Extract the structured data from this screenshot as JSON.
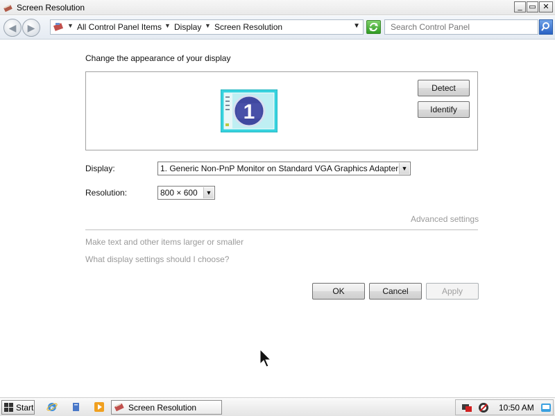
{
  "window": {
    "title": "Screen Resolution",
    "minimize_glyph": "_",
    "maximize_glyph": "▭",
    "close_glyph": "✕"
  },
  "navigation": {
    "back_glyph": "◀",
    "forward_glyph": "▶",
    "breadcrumbs": [
      "All Control Panel Items",
      "Display",
      "Screen Resolution"
    ],
    "crumb_separator_glyph": "▼",
    "history_dropdown_glyph": "▼",
    "search_placeholder": "Search Control Panel"
  },
  "page": {
    "heading": "Change the appearance of your display",
    "monitor_number": "1",
    "detect_label": "Detect",
    "identify_label": "Identify",
    "display_label": "Display:",
    "display_value": "1. Generic Non-PnP Monitor on Standard VGA Graphics Adapter",
    "resolution_label": "Resolution:",
    "resolution_value": "800 × 600",
    "dropdown_glyph": "▼",
    "advanced_settings_link": "Advanced settings",
    "text_size_link": "Make text and other items larger or smaller",
    "help_link": "What display settings should I choose?",
    "ok_label": "OK",
    "cancel_label": "Cancel",
    "apply_label": "Apply"
  },
  "taskbar": {
    "start_label": "Start",
    "task_item_label": "Screen Resolution",
    "clock": "10:50 AM"
  },
  "colors": {
    "link_disabled": "#9a9a9a",
    "monitor_teal": "#36d2de",
    "monitor_badge": "#4048a0"
  }
}
